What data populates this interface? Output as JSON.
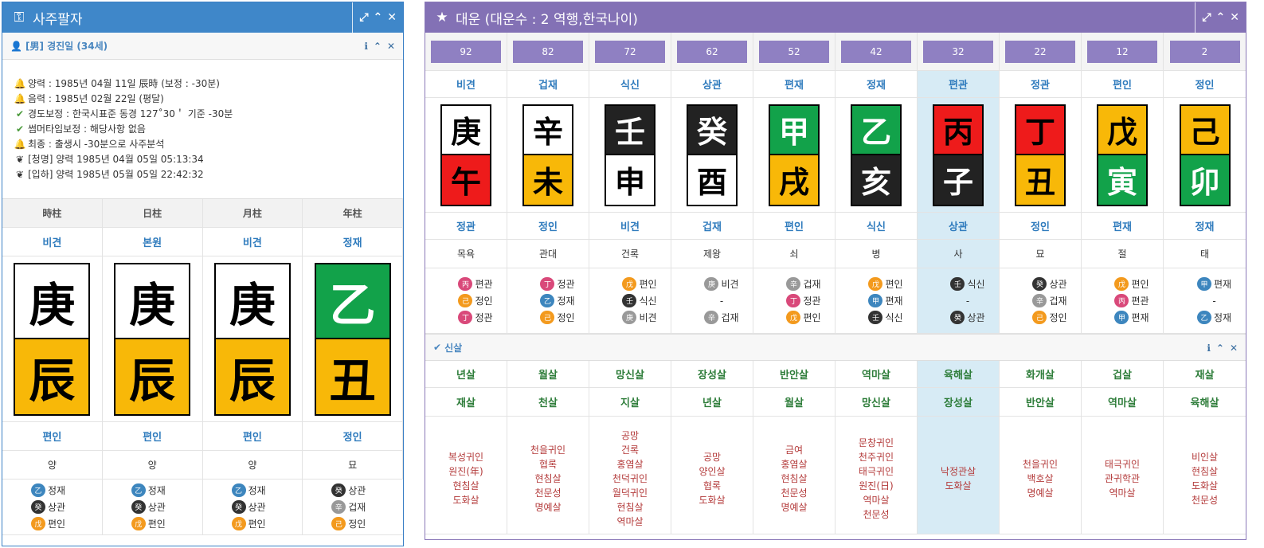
{
  "left": {
    "title": "사주팔자",
    "person": "[男] 경진일 (34세)",
    "info": [
      {
        "icon": "bell-icon",
        "text": "양력 : 1985년 04월 11일 辰時 (보정 : -30분)"
      },
      {
        "icon": "bell-icon",
        "text": "음력 : 1985년 02월 22일 (평달)"
      },
      {
        "icon": "check-icon",
        "text": "경도보정 : 한국시표준 동경 127˚30＇ 기준 -30분"
      },
      {
        "icon": "check-icon",
        "text": "썸머타임보정 : 해당사항 없음"
      },
      {
        "icon": "bell-icon",
        "text": "최종 : 출생시 -30분으로 사주분석"
      },
      {
        "icon": "leaf-icon",
        "text": "[청명] 양력 1985년 04월 05일 05:13:34"
      },
      {
        "icon": "leaf-icon",
        "text": "[입하] 양력 1985년 05월 05일 22:42:32"
      }
    ],
    "headers": [
      "時柱",
      "日柱",
      "月柱",
      "年柱"
    ],
    "top_gods": [
      "비견",
      "본원",
      "비견",
      "정재"
    ],
    "stems": [
      {
        "char": "庚",
        "color": "white"
      },
      {
        "char": "庚",
        "color": "white"
      },
      {
        "char": "庚",
        "color": "white"
      },
      {
        "char": "乙",
        "color": "green"
      }
    ],
    "branches": [
      {
        "char": "辰",
        "color": "yellow"
      },
      {
        "char": "辰",
        "color": "yellow"
      },
      {
        "char": "辰",
        "color": "yellow"
      },
      {
        "char": "丑",
        "color": "yellow"
      }
    ],
    "bottom_gods": [
      "편인",
      "편인",
      "편인",
      "정인"
    ],
    "stages": [
      "양",
      "양",
      "양",
      "묘"
    ],
    "hidden": [
      [
        {
          "c": "乙",
          "col": "blue",
          "t": "정재"
        },
        {
          "c": "癸",
          "col": "black",
          "t": "상관"
        },
        {
          "c": "戊",
          "col": "orange",
          "t": "편인"
        }
      ],
      [
        {
          "c": "乙",
          "col": "blue",
          "t": "정재"
        },
        {
          "c": "癸",
          "col": "black",
          "t": "상관"
        },
        {
          "c": "戊",
          "col": "orange",
          "t": "편인"
        }
      ],
      [
        {
          "c": "乙",
          "col": "blue",
          "t": "정재"
        },
        {
          "c": "癸",
          "col": "black",
          "t": "상관"
        },
        {
          "c": "戊",
          "col": "orange",
          "t": "편인"
        }
      ],
      [
        {
          "c": "癸",
          "col": "black",
          "t": "상관"
        },
        {
          "c": "辛",
          "col": "gray",
          "t": "겁재"
        },
        {
          "c": "己",
          "col": "orange",
          "t": "정인"
        }
      ]
    ]
  },
  "right": {
    "title": "대운 (대운수 : 2 역행,한국나이)",
    "ages": [
      "92",
      "82",
      "72",
      "62",
      "52",
      "42",
      "32",
      "22",
      "12",
      "2"
    ],
    "highlight_index": 6,
    "top_gods": [
      "비견",
      "겁재",
      "식신",
      "상관",
      "편재",
      "정재",
      "편관",
      "정관",
      "편인",
      "정인"
    ],
    "stems": [
      {
        "char": "庚",
        "color": "white"
      },
      {
        "char": "辛",
        "color": "white"
      },
      {
        "char": "壬",
        "color": "black"
      },
      {
        "char": "癸",
        "color": "black"
      },
      {
        "char": "甲",
        "color": "green"
      },
      {
        "char": "乙",
        "color": "green"
      },
      {
        "char": "丙",
        "color": "red"
      },
      {
        "char": "丁",
        "color": "red"
      },
      {
        "char": "戊",
        "color": "yellow"
      },
      {
        "char": "己",
        "color": "yellow"
      }
    ],
    "branches": [
      {
        "char": "午",
        "color": "red"
      },
      {
        "char": "未",
        "color": "yellow"
      },
      {
        "char": "申",
        "color": "white"
      },
      {
        "char": "酉",
        "color": "white"
      },
      {
        "char": "戌",
        "color": "yellow"
      },
      {
        "char": "亥",
        "color": "black"
      },
      {
        "char": "子",
        "color": "black"
      },
      {
        "char": "丑",
        "color": "yellow"
      },
      {
        "char": "寅",
        "color": "green"
      },
      {
        "char": "卯",
        "color": "green"
      }
    ],
    "bottom_gods": [
      "정관",
      "정인",
      "비견",
      "겁재",
      "편인",
      "식신",
      "상관",
      "정인",
      "편재",
      "정재"
    ],
    "stages": [
      "목욕",
      "관대",
      "건록",
      "제왕",
      "쇠",
      "병",
      "사",
      "묘",
      "절",
      "태"
    ],
    "hidden": [
      [
        {
          "c": "丙",
          "col": "pink",
          "t": "편관"
        },
        {
          "c": "己",
          "col": "orange",
          "t": "정인"
        },
        {
          "c": "丁",
          "col": "pink",
          "t": "정관"
        }
      ],
      [
        {
          "c": "丁",
          "col": "pink",
          "t": "정관"
        },
        {
          "c": "乙",
          "col": "blue",
          "t": "정재"
        },
        {
          "c": "己",
          "col": "orange",
          "t": "정인"
        }
      ],
      [
        {
          "c": "戊",
          "col": "orange",
          "t": "편인"
        },
        {
          "c": "壬",
          "col": "black",
          "t": "식신"
        },
        {
          "c": "庚",
          "col": "gray",
          "t": "비견"
        }
      ],
      [
        {
          "c": "庚",
          "col": "gray",
          "t": "비견"
        },
        {
          "dash": "-"
        },
        {
          "c": "辛",
          "col": "gray",
          "t": "겁재"
        }
      ],
      [
        {
          "c": "辛",
          "col": "gray",
          "t": "겁재"
        },
        {
          "c": "丁",
          "col": "pink",
          "t": "정관"
        },
        {
          "c": "戊",
          "col": "orange",
          "t": "편인"
        }
      ],
      [
        {
          "c": "戊",
          "col": "orange",
          "t": "편인"
        },
        {
          "c": "甲",
          "col": "blue",
          "t": "편재"
        },
        {
          "c": "壬",
          "col": "black",
          "t": "식신"
        }
      ],
      [
        {
          "c": "壬",
          "col": "black",
          "t": "식신"
        },
        {
          "dash": "-"
        },
        {
          "c": "癸",
          "col": "black",
          "t": "상관"
        }
      ],
      [
        {
          "c": "癸",
          "col": "black",
          "t": "상관"
        },
        {
          "c": "辛",
          "col": "gray",
          "t": "겁재"
        },
        {
          "c": "己",
          "col": "orange",
          "t": "정인"
        }
      ],
      [
        {
          "c": "戊",
          "col": "orange",
          "t": "편인"
        },
        {
          "c": "丙",
          "col": "pink",
          "t": "편관"
        },
        {
          "c": "甲",
          "col": "blue",
          "t": "편재"
        }
      ],
      [
        {
          "c": "甲",
          "col": "blue",
          "t": "편재"
        },
        {
          "dash": "-"
        },
        {
          "c": "乙",
          "col": "blue",
          "t": "정재"
        }
      ]
    ],
    "sinsal_title": "신살",
    "sinsal_row1": [
      "년살",
      "월살",
      "망신살",
      "장성살",
      "반안살",
      "역마살",
      "육해살",
      "화개살",
      "겁살",
      "재살"
    ],
    "sinsal_row2": [
      "재살",
      "천살",
      "지살",
      "년살",
      "월살",
      "망신살",
      "장성살",
      "반안살",
      "역마살",
      "육해살"
    ],
    "sinsal_lists": [
      [
        "복성귀인",
        "원진(年)",
        "현침살",
        "도화살"
      ],
      [
        "천을귀인",
        "협록",
        "현침살",
        "천문성",
        "명예살"
      ],
      [
        "공망",
        "건록",
        "홍염살",
        "천덕귀인",
        "월덕귀인",
        "현침살",
        "역마살"
      ],
      [
        "공망",
        "양인살",
        "협록",
        "도화살"
      ],
      [
        "금여",
        "홍염살",
        "현침살",
        "천문성",
        "명예살"
      ],
      [
        "문창귀인",
        "천주귀인",
        "태극귀인",
        "원진(日)",
        "역마살",
        "천문성"
      ],
      [
        "낙정관살",
        "도화살"
      ],
      [
        "천을귀인",
        "백호살",
        "명예살"
      ],
      [
        "태극귀인",
        "관귀학관",
        "역마살"
      ],
      [
        "비인살",
        "현침살",
        "도화살",
        "천문성"
      ]
    ]
  }
}
